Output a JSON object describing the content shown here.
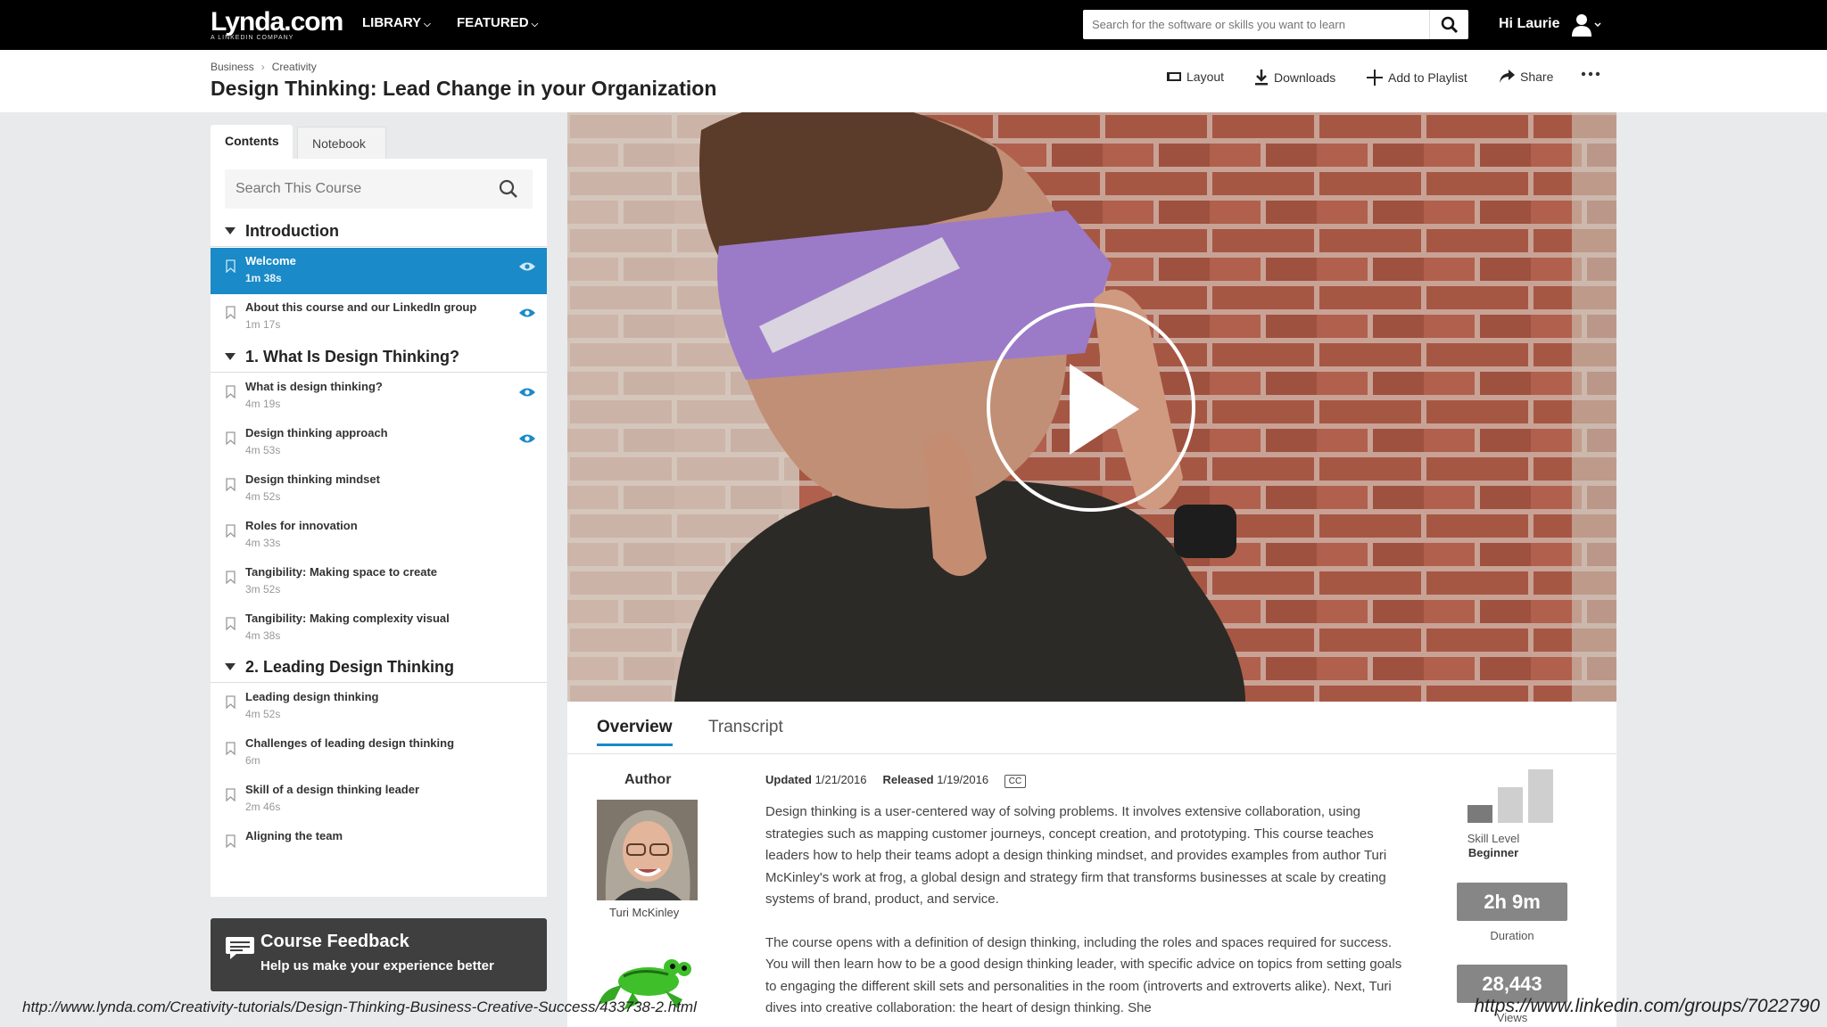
{
  "topbar": {
    "logo_text": "Lynda.com",
    "logo_sub": "A LINKEDIN COMPANY",
    "nav": [
      "LIBRARY",
      "FEATURED"
    ],
    "search_placeholder": "Search for the software or skills you want to learn",
    "greeting": "Hi Laurie"
  },
  "header": {
    "breadcrumbs": [
      "Business",
      "Creativity"
    ],
    "title": "Design Thinking: Lead Change in your Organization",
    "actions": [
      "Layout",
      "Downloads",
      "Add to Playlist",
      "Share"
    ]
  },
  "sidebar": {
    "tabs": [
      "Contents",
      "Notebook"
    ],
    "search_placeholder": "Search This Course",
    "chapters": [
      {
        "title": "Introduction",
        "items": [
          {
            "title": "Welcome",
            "duration": "1m 38s",
            "active": true,
            "viewed": true
          },
          {
            "title": "About this course and our LinkedIn group",
            "duration": "1m 17s",
            "viewed": true
          }
        ]
      },
      {
        "title": "1. What Is Design Thinking?",
        "items": [
          {
            "title": "What is design thinking?",
            "duration": "4m 19s",
            "viewed": true
          },
          {
            "title": "Design thinking approach",
            "duration": "4m 53s",
            "viewed": true
          },
          {
            "title": "Design thinking mindset",
            "duration": "4m 52s"
          },
          {
            "title": "Roles for innovation",
            "duration": "4m 33s"
          },
          {
            "title": "Tangibility: Making space to create",
            "duration": "3m 52s"
          },
          {
            "title": "Tangibility: Making complexity visual",
            "duration": "4m 38s"
          }
        ]
      },
      {
        "title": "2. Leading Design Thinking",
        "items": [
          {
            "title": "Leading design thinking",
            "duration": "4m 52s"
          },
          {
            "title": "Challenges of leading design thinking",
            "duration": "6m"
          },
          {
            "title": "Skill of a design thinking leader",
            "duration": "2m 46s"
          },
          {
            "title": "Aligning the team",
            "duration": ""
          }
        ]
      }
    ],
    "feedback": {
      "title": "Course Feedback",
      "subtitle": "Help us make your experience better"
    }
  },
  "info": {
    "tabs": [
      "Overview",
      "Transcript"
    ],
    "author_heading": "Author",
    "author_name": "Turi McKinley",
    "updated_label": "Updated",
    "updated": "1/21/2016",
    "released_label": "Released",
    "released": "1/19/2016",
    "cc": "CC",
    "description": [
      "Design thinking is a user-centered way of solving problems. It involves extensive collaboration, using strategies such as mapping customer journeys, concept creation, and prototyping. This course teaches leaders how to help their teams adopt a design thinking mindset, and provides examples from author Turi McKinley's work at frog, a global design and strategy firm that transforms businesses at scale by creating systems of brand, product, and service.",
      "The course opens with a definition of design thinking, including the roles and spaces required for success. You will then learn how to be a good design thinking leader, with specific advice on topics from setting goals to engaging the different skill sets and personalities in the room (introverts and extroverts alike). Next, Turi dives into creative collaboration: the heart of design thinking. She"
    ],
    "skill_label": "Skill Level",
    "skill_value": "Beginner",
    "skill_level_of_3": 1,
    "duration": "2h 9m",
    "duration_label": "Duration",
    "views": "28,443",
    "views_label": "Views"
  },
  "overlay": {
    "url_left": "http://www.lynda.com/Creativity-tutorials/Design-Thinking-Business-Creative-Success/433738-2.html",
    "url_right": "https://www.linkedin.com/groups/7022790"
  },
  "colors": {
    "accent": "#1a8ac8",
    "topbar": "#000000",
    "feedback": "#3f3f3f",
    "stat_box": "#868686"
  }
}
